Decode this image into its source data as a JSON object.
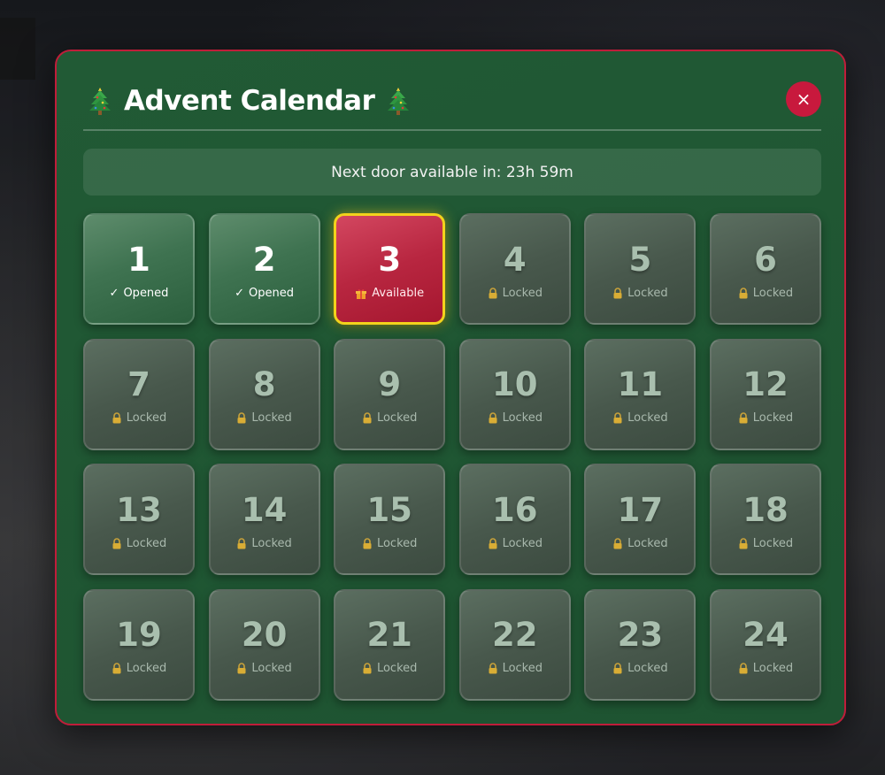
{
  "modal": {
    "title": "Advent Calendar",
    "title_icon": "christmas-tree-icon",
    "close_label": "×",
    "timer_text": "Next door available in: 23h 59m",
    "colors": {
      "panel": "#215a35",
      "border": "#c01d3a",
      "close": "#c8193d",
      "available": "#b82640",
      "available_border": "#f3d21c"
    }
  },
  "doors": [
    {
      "day": "1",
      "state": "opened",
      "status_label": "Opened",
      "icon": "check-icon"
    },
    {
      "day": "2",
      "state": "opened",
      "status_label": "Opened",
      "icon": "check-icon"
    },
    {
      "day": "3",
      "state": "available",
      "status_label": "Available",
      "icon": "gift-icon"
    },
    {
      "day": "4",
      "state": "locked",
      "status_label": "Locked",
      "icon": "lock-icon"
    },
    {
      "day": "5",
      "state": "locked",
      "status_label": "Locked",
      "icon": "lock-icon"
    },
    {
      "day": "6",
      "state": "locked",
      "status_label": "Locked",
      "icon": "lock-icon"
    },
    {
      "day": "7",
      "state": "locked",
      "status_label": "Locked",
      "icon": "lock-icon"
    },
    {
      "day": "8",
      "state": "locked",
      "status_label": "Locked",
      "icon": "lock-icon"
    },
    {
      "day": "9",
      "state": "locked",
      "status_label": "Locked",
      "icon": "lock-icon"
    },
    {
      "day": "10",
      "state": "locked",
      "status_label": "Locked",
      "icon": "lock-icon"
    },
    {
      "day": "11",
      "state": "locked",
      "status_label": "Locked",
      "icon": "lock-icon"
    },
    {
      "day": "12",
      "state": "locked",
      "status_label": "Locked",
      "icon": "lock-icon"
    },
    {
      "day": "13",
      "state": "locked",
      "status_label": "Locked",
      "icon": "lock-icon"
    },
    {
      "day": "14",
      "state": "locked",
      "status_label": "Locked",
      "icon": "lock-icon"
    },
    {
      "day": "15",
      "state": "locked",
      "status_label": "Locked",
      "icon": "lock-icon"
    },
    {
      "day": "16",
      "state": "locked",
      "status_label": "Locked",
      "icon": "lock-icon"
    },
    {
      "day": "17",
      "state": "locked",
      "status_label": "Locked",
      "icon": "lock-icon"
    },
    {
      "day": "18",
      "state": "locked",
      "status_label": "Locked",
      "icon": "lock-icon"
    },
    {
      "day": "19",
      "state": "locked",
      "status_label": "Locked",
      "icon": "lock-icon"
    },
    {
      "day": "20",
      "state": "locked",
      "status_label": "Locked",
      "icon": "lock-icon"
    },
    {
      "day": "21",
      "state": "locked",
      "status_label": "Locked",
      "icon": "lock-icon"
    },
    {
      "day": "22",
      "state": "locked",
      "status_label": "Locked",
      "icon": "lock-icon"
    },
    {
      "day": "23",
      "state": "locked",
      "status_label": "Locked",
      "icon": "lock-icon"
    },
    {
      "day": "24",
      "state": "locked",
      "status_label": "Locked",
      "icon": "lock-icon"
    }
  ]
}
